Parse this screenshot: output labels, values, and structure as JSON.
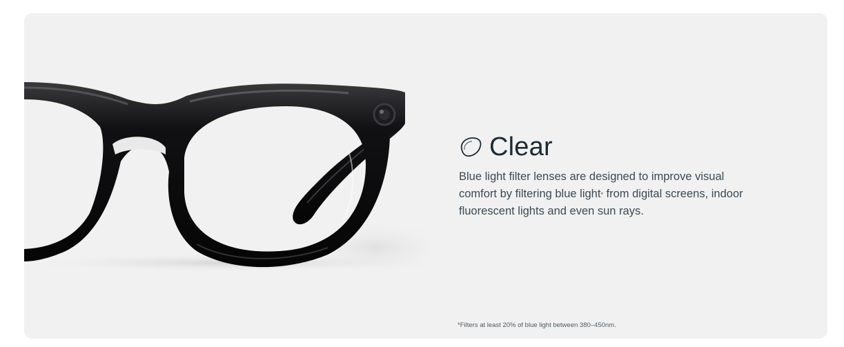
{
  "product": {
    "title": "Clear",
    "icon": "lens-icon",
    "description_part1": "Blue light filter lenses are designed to improve visual comfort by filtering blue light",
    "description_mark": "*",
    "description_part2": " from digital screens, indoor fluorescent lights and even sun rays.",
    "footnote": "*Filters at least 20% of blue light between 380–450nm."
  },
  "colors": {
    "card_background": "#f1f1f1",
    "title": "#1c2b33",
    "frame": "#0b0b0c"
  }
}
